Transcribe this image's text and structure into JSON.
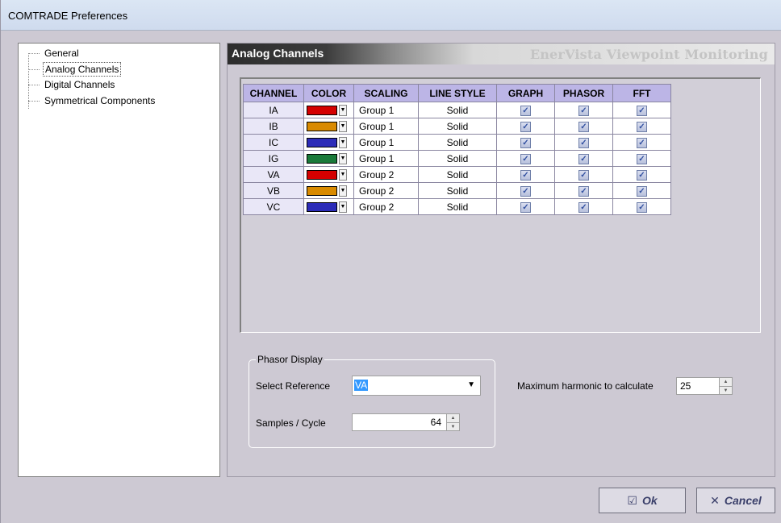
{
  "window": {
    "title": "COMTRADE Preferences"
  },
  "tree": {
    "items": [
      {
        "label": "General",
        "selected": false
      },
      {
        "label": "Analog Channels",
        "selected": true
      },
      {
        "label": "Digital Channels",
        "selected": false
      },
      {
        "label": "Symmetrical Components",
        "selected": false
      }
    ]
  },
  "header": {
    "section_title": "Analog Channels",
    "brand": "EnerVista Viewpoint Monitoring"
  },
  "grid": {
    "columns": [
      "CHANNEL",
      "COLOR",
      "SCALING",
      "LINE STYLE",
      "GRAPH",
      "PHASOR",
      "FFT"
    ],
    "rows": [
      {
        "channel": "IA",
        "color": "#d40000",
        "scaling": "Group 1",
        "line_style": "Solid",
        "graph": true,
        "phasor": true,
        "fft": true
      },
      {
        "channel": "IB",
        "color": "#d98a00",
        "scaling": "Group 1",
        "line_style": "Solid",
        "graph": true,
        "phasor": true,
        "fft": true
      },
      {
        "channel": "IC",
        "color": "#2c2cb8",
        "scaling": "Group 1",
        "line_style": "Solid",
        "graph": true,
        "phasor": true,
        "fft": true
      },
      {
        "channel": "IG",
        "color": "#1a7a3a",
        "scaling": "Group 1",
        "line_style": "Solid",
        "graph": true,
        "phasor": true,
        "fft": true
      },
      {
        "channel": "VA",
        "color": "#d40000",
        "scaling": "Group 2",
        "line_style": "Solid",
        "graph": true,
        "phasor": true,
        "fft": true
      },
      {
        "channel": "VB",
        "color": "#d98a00",
        "scaling": "Group 2",
        "line_style": "Solid",
        "graph": true,
        "phasor": true,
        "fft": true
      },
      {
        "channel": "VC",
        "color": "#2c2cb8",
        "scaling": "Group 2",
        "line_style": "Solid",
        "graph": true,
        "phasor": true,
        "fft": true
      }
    ]
  },
  "phasor_display": {
    "legend": "Phasor Display",
    "select_reference_label": "Select Reference",
    "select_reference_value": "VA",
    "samples_label": "Samples / Cycle",
    "samples_value": "64"
  },
  "harmonic": {
    "label": "Maximum harmonic to calculate",
    "value": "25"
  },
  "buttons": {
    "ok": "Ok",
    "cancel": "Cancel"
  }
}
